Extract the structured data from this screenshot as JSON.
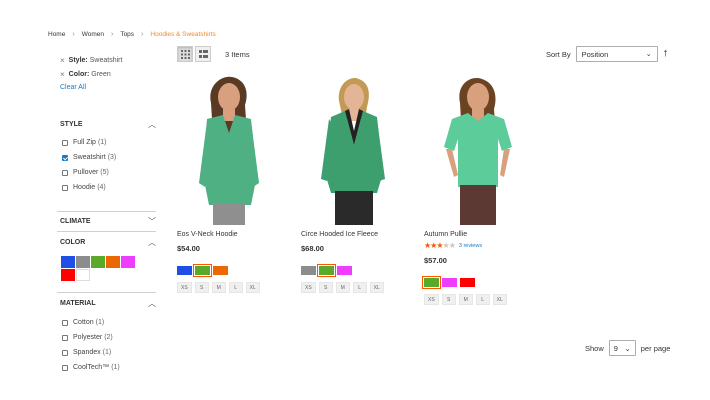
{
  "breadcrumb": {
    "items": [
      "Home",
      "Women",
      "Tops"
    ],
    "current": "Hoodies & Sweatshirts"
  },
  "active_filters": [
    {
      "name": "Style:",
      "value": "Sweatshirt"
    },
    {
      "name": "Color:",
      "value": "Green"
    }
  ],
  "clear_all": "Clear All",
  "style_filter": {
    "title": "STYLE",
    "options": [
      {
        "label": "Full Zip",
        "count": "(1)",
        "checked": false
      },
      {
        "label": "Sweatshirt",
        "count": "(3)",
        "checked": true
      },
      {
        "label": "Pullover",
        "count": "(5)",
        "checked": false
      },
      {
        "label": "Hoodie",
        "count": "(4)",
        "checked": false
      }
    ]
  },
  "climate_filter": {
    "title": "CLIMATE"
  },
  "color_filter": {
    "title": "COLOR",
    "swatches": [
      "#1f4fe6",
      "#8c8c8c",
      "#59a92b",
      "#eb6703",
      "#ef3dff",
      "#ff0000",
      "#ffffff"
    ]
  },
  "material_filter": {
    "title": "MATERIAL",
    "options": [
      {
        "label": "Cotton",
        "count": "(1)"
      },
      {
        "label": "Polyester",
        "count": "(2)"
      },
      {
        "label": "Spandex",
        "count": "(1)"
      },
      {
        "label": "CoolTech™",
        "count": "(1)"
      }
    ]
  },
  "toolbar": {
    "items_count": "3 Items",
    "sort_label": "Sort By",
    "sort_value": "Position",
    "show_label": "Show",
    "limit_value": "9",
    "per_page_label": "per page"
  },
  "products": [
    {
      "name": "Eos V-Neck Hoodie",
      "price": "$54.00",
      "colors": [
        "#1f4fe6",
        "#59a92b",
        "#eb6703"
      ],
      "selected_color": 1,
      "sizes": [
        "XS",
        "S",
        "M",
        "L",
        "XL"
      ],
      "skin": "#d9a07f",
      "hair": "#5a3a22",
      "top": "#4fb083",
      "bottom": "#8f8f8f"
    },
    {
      "name": "Circe Hooded Ice Fleece",
      "price": "$68.00",
      "colors": [
        "#8c8c8c",
        "#59a92b",
        "#ef3dff"
      ],
      "selected_color": 1,
      "sizes": [
        "XS",
        "S",
        "M",
        "L",
        "XL"
      ],
      "skin": "#e4b496",
      "hair": "#c29a55",
      "top": "#3e9f6e",
      "bottom": "#2a2a2a"
    },
    {
      "name": "Autumn Pullie",
      "rating": 3,
      "reviews": "3 reviews",
      "price": "$57.00",
      "colors": [
        "#59a92b",
        "#ef3dff",
        "#ff0000"
      ],
      "selected_color": 0,
      "sizes": [
        "XS",
        "S",
        "M",
        "L",
        "XL"
      ],
      "skin": "#d8a07c",
      "hair": "#6b4322",
      "top": "#5ccc9a",
      "bottom": "#5c3a33"
    }
  ]
}
